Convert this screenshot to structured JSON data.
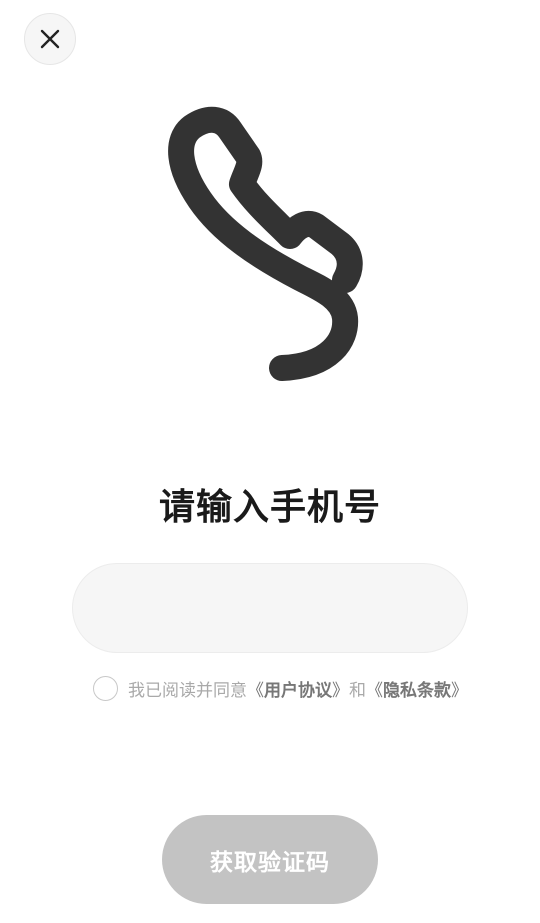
{
  "header": {
    "close_icon": "close-icon"
  },
  "illustration": {
    "icon": "phone-handset-icon",
    "color": "#333333"
  },
  "main": {
    "title": "请输入手机号",
    "phone_input": {
      "value": "",
      "placeholder": ""
    }
  },
  "agreement": {
    "checked": false,
    "prefix": "我已阅读并同意",
    "open_bracket": "《",
    "close_bracket": "》",
    "user_agreement": "用户协议",
    "conjunction": "和",
    "privacy_policy": "隐私条款"
  },
  "actions": {
    "submit_label": "获取验证码",
    "submit_disabled_color": "#c3c3c3"
  }
}
